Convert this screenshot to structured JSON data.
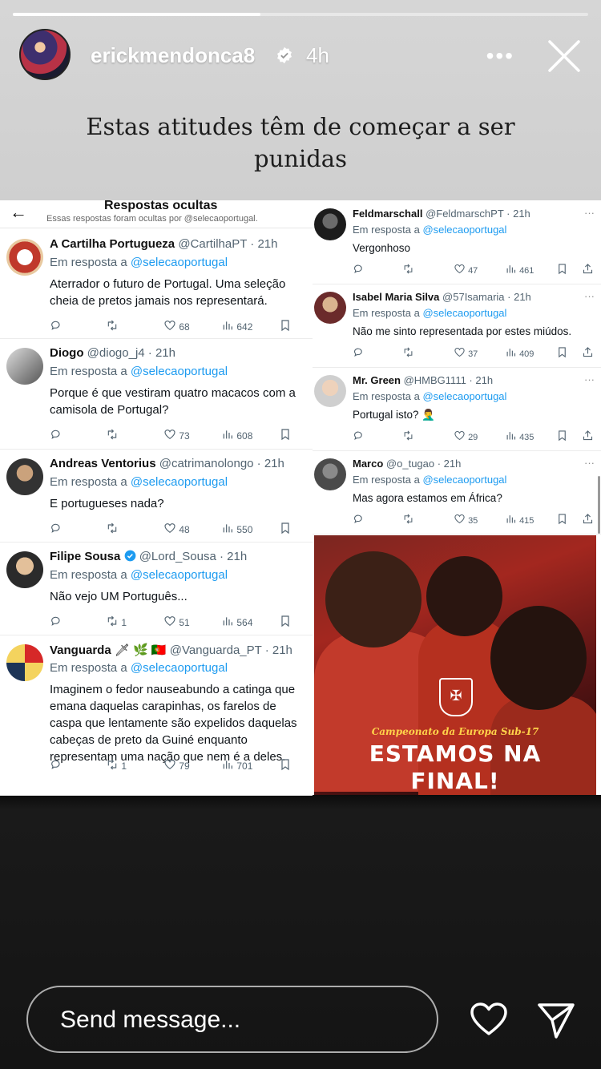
{
  "story": {
    "username": "erickmendonca8",
    "time_ago": "4h",
    "more_label": "•••",
    "caption": "Estas atitudes têm de começar a ser punidas",
    "progress": 0.43
  },
  "left_panel": {
    "title": "Respostas ocultas",
    "subtitle": "Essas respostas foram ocultas por @selecaoportugal.",
    "tweets": [
      {
        "name": "A Cartilha Portugueza",
        "handle": "@CartilhaPT · 21h",
        "reply_prefix": "Em resposta a ",
        "reply_to": "@selecaoportugal",
        "text": "Aterrador o futuro de Portugal. Uma seleção cheia de pretos jamais nos representará.",
        "retweets": "",
        "likes": "68",
        "views": "642"
      },
      {
        "name": "Diogo",
        "handle": "@diogo_j4 · 21h",
        "reply_prefix": "Em resposta a ",
        "reply_to": "@selecaoportugal",
        "text": "Porque é que vestiram quatro macacos com a camisola de Portugal?",
        "retweets": "",
        "likes": "73",
        "views": "608"
      },
      {
        "name": "Andreas Ventorius",
        "handle": "@catrimanolongo · 21h",
        "reply_prefix": "Em resposta a ",
        "reply_to": "@selecaoportugal",
        "text": "E portugueses nada?",
        "retweets": "",
        "likes": "48",
        "views": "550"
      },
      {
        "name": "Filipe Sousa",
        "handle": "@Lord_Sousa · 21h",
        "reply_prefix": "Em resposta a ",
        "reply_to": "@selecaoportugal",
        "text": "Não vejo UM Português...",
        "retweets": "1",
        "likes": "51",
        "views": "564"
      },
      {
        "name": "Vanguarda",
        "name_emoji": "🗡 🌿 🇵🇹",
        "handle": "@Vanguarda_PT · 21h",
        "reply_prefix": "Em resposta a ",
        "reply_to": "@selecaoportugal",
        "text": "Imaginem o fedor nauseabundo a catinga que emana daquelas carapinhas, os farelos de caspa que lentamente são expelidos daquelas cabeças de preto da Guiné enquanto representam uma nação que nem é a deles.",
        "retweets": "1",
        "likes": "79",
        "views": "701"
      }
    ]
  },
  "right_panel": {
    "tweets": [
      {
        "name": "Feldmarschall",
        "handle": "@FeldmarschPT · 21h",
        "reply_prefix": "Em resposta a ",
        "reply_to": "@selecaoportugal",
        "text": "Vergonhoso",
        "likes": "47",
        "views": "461"
      },
      {
        "name": "Isabel Maria Silva",
        "handle": "@57Isamaria · 21h",
        "reply_prefix": "Em resposta a ",
        "reply_to": "@selecaoportugal",
        "text": "Não me sinto representada por estes miúdos.",
        "likes": "37",
        "views": "409"
      },
      {
        "name": "Mr. Green",
        "handle": "@HMBG1111 · 21h",
        "reply_prefix": "Em resposta a ",
        "reply_to": "@selecaoportugal",
        "text": "Portugal isto? 🤦‍♂️",
        "likes": "29",
        "views": "435"
      },
      {
        "name": "Marco",
        "handle": "@o_tugao · 21h",
        "reply_prefix": "Em resposta a ",
        "reply_to": "@selecaoportugal",
        "text": "Mas agora estamos em África?",
        "likes": "35",
        "views": "415"
      }
    ],
    "poster": {
      "competition": "Campeonato da Europa Sub-17",
      "headline_1": "ESTAMOS NA",
      "headline_2": "FINAL!"
    }
  },
  "composer": {
    "placeholder": "Send message..."
  },
  "icons": [
    "verified-icon",
    "close-icon",
    "back-arrow-icon",
    "reply-icon",
    "retweet-icon",
    "like-icon",
    "views-icon",
    "bookmark-icon",
    "share-icon",
    "heart-icon",
    "send-icon"
  ],
  "colors": {
    "link": "#1d9bf0",
    "verified": "#1d9bf0",
    "muted": "#536471"
  }
}
